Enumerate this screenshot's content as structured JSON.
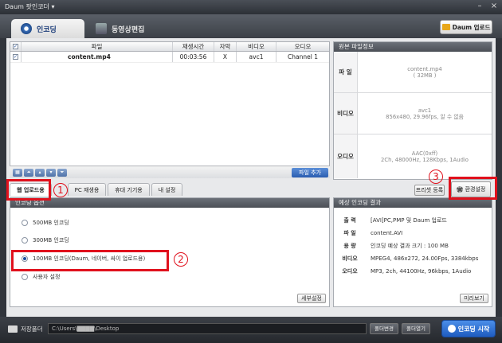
{
  "window": {
    "title": "Daum 팟인코더 ▾"
  },
  "tabs": {
    "encode": "인코딩",
    "edit": "동영상편집"
  },
  "upload_top": "Daum 업로드",
  "file_table": {
    "headers": [
      "파일",
      "재생시간",
      "자막",
      "비디오",
      "오디오"
    ],
    "row": {
      "file": "content.mp4",
      "duration": "00:03:56",
      "subtitle": "X",
      "video": "avc1",
      "audio": "Channel 1"
    }
  },
  "list_add": "파일 추가",
  "original_info": {
    "title": "원본 파일정보",
    "file_label": "파 일",
    "file_name": "content.mp4",
    "file_size": "( 32MB )",
    "video_label": "비디오",
    "video_codec": "avc1",
    "video_detail": "856x480, 29.96fps, 알 수 없음",
    "audio_label": "오디오",
    "audio_codec": "AAC(0xff)",
    "audio_detail": "2Ch, 48000Hz, 128Kbps, 1Audio"
  },
  "preset_button": "프리셋 등록",
  "env_button": "환경설정",
  "subtabs": [
    "웹 업로드용",
    "PC 재생용",
    "휴대 기기용",
    "내 설정"
  ],
  "options": {
    "title": "인코딩 옵션",
    "items": [
      "500MB 인코딩",
      "300MB 인코딩",
      "100MB 인코딩(Daum, 네이버, 싸이 업로드용)",
      "사용자 설정"
    ],
    "selected_index": 2,
    "detail_button": "세부설정"
  },
  "result": {
    "title": "예상 인코딩 결과",
    "rows": [
      {
        "label": "출 력",
        "value": "[AVI]PC,PMP 및 Daum 업로드"
      },
      {
        "label": "파 일",
        "value": "content.AVI"
      },
      {
        "label": "용 량",
        "value": "인코딩 예상 결과 크기 : 100 MB"
      },
      {
        "label": "비디오",
        "value": "MPEG4, 486x272, 24.00Fps, 3384kbps"
      },
      {
        "label": "오디오",
        "value": "MP3, 2ch, 44100Hz, 96kbps, 1Audio"
      }
    ],
    "preview_button": "미리보기"
  },
  "bottom": {
    "save_label": "저장폴더",
    "path": "C:\\Users\\▇▇▇▇\\Desktop",
    "open_folder": "폴더변경",
    "open": "폴더열기",
    "start": "인코딩 시작"
  },
  "annotations": {
    "one": "1",
    "two": "2",
    "three": "3"
  },
  "colors": {
    "annotation": "#e0111d",
    "accent": "#2a5db0"
  }
}
